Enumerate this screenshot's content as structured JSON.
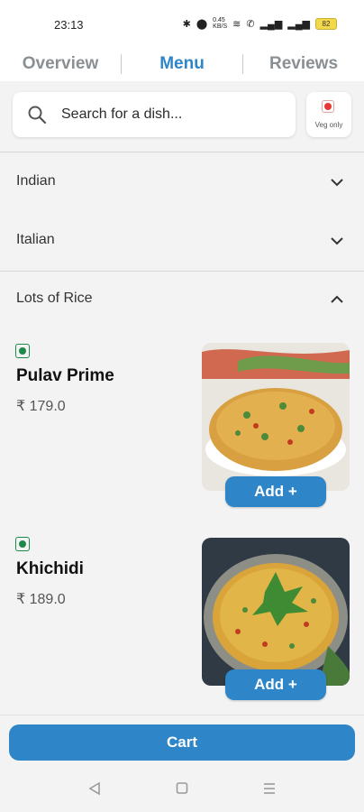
{
  "status_bar": {
    "time": "23:13",
    "network_speed": "0.45\nKB/S",
    "battery": "82"
  },
  "tabs": [
    {
      "label": "Overview",
      "active": false
    },
    {
      "label": "Menu",
      "active": true
    },
    {
      "label": "Reviews",
      "active": false
    }
  ],
  "search": {
    "placeholder": "Search for a dish...",
    "veg_only_label": "Veg only"
  },
  "categories": [
    {
      "name": "Indian",
      "expanded": false
    },
    {
      "name": "Italian",
      "expanded": false
    },
    {
      "name": "Lots of Rice",
      "expanded": true
    }
  ],
  "dishes": [
    {
      "name": "Pulav Prime",
      "price": "₹ 179.0",
      "add_label": "Add +",
      "veg": true
    },
    {
      "name": "Khichidi",
      "price": "₹ 189.0",
      "add_label": "Add +",
      "veg": true
    }
  ],
  "cart": {
    "label": "Cart"
  },
  "colors": {
    "accent": "#2e86c9",
    "veg_green": "#1b8a4a",
    "nonveg_red": "#e53935"
  }
}
